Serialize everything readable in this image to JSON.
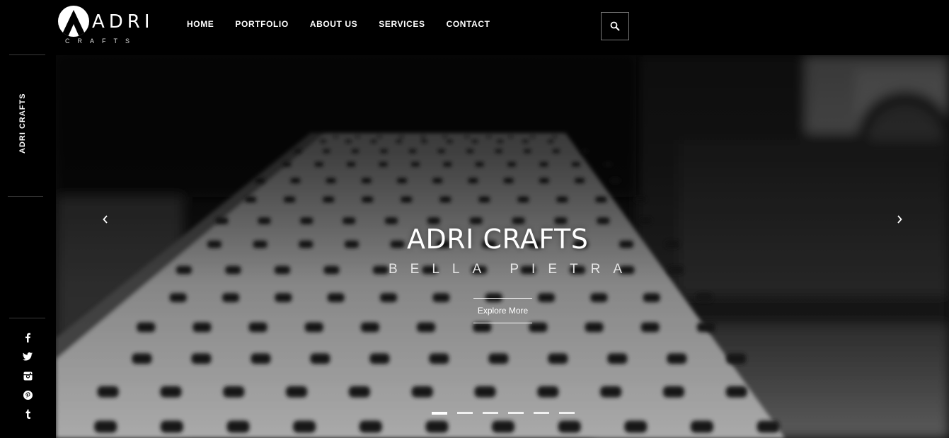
{
  "brand": {
    "name": "ADRI",
    "tagline": "CRAFTS",
    "vertical_label": "ADRI CRAFTS"
  },
  "nav": [
    {
      "label": "HOME"
    },
    {
      "label": "PORTFOLIO"
    },
    {
      "label": "ABOUT US"
    },
    {
      "label": "SERVICES"
    },
    {
      "label": "CONTACT"
    }
  ],
  "header": {
    "search_icon": "search-icon"
  },
  "social": [
    "facebook-icon",
    "twitter-icon",
    "instagram-icon",
    "pinterest-icon",
    "tumblr-icon"
  ],
  "hero": {
    "title": "ADRI CRAFTS",
    "subtitle": "BELLA PIETRA",
    "cta": "Explore More",
    "slide_count": 6,
    "active_slide": 1
  },
  "colors": {
    "background": "#000000",
    "text": "#ffffff"
  }
}
